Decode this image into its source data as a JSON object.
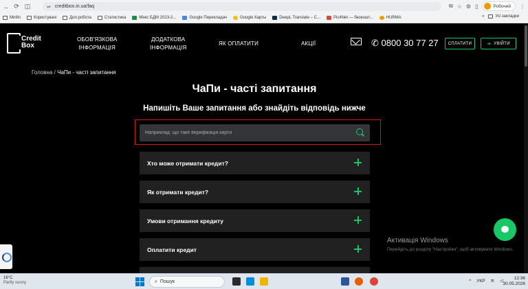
{
  "browser": {
    "url": "creditbox.in.ua/faq",
    "profile_label": "Робочий",
    "bookmarks": [
      "Minfin",
      "Користувачі",
      "Доп.робота",
      "Статистика",
      "Мініс БДМ 2023-2...",
      "Google Перекладач",
      "Google Карты",
      "DeepL Translate – C...",
      "Pic4Net — безкошт...",
      "HURMA"
    ],
    "bookmarks_more": "»",
    "all_bookmarks": "Усі закладки"
  },
  "header": {
    "logo_line1": "Credit",
    "logo_line2": "Box",
    "nav": [
      {
        "line1": "ОБОВ'ЯЗКОВА",
        "line2": "ІНФОРМАЦІЯ"
      },
      {
        "line1": "ДОДАТКОВА",
        "line2": "ІНФОРМАЦІЯ"
      },
      {
        "line1": "ЯК ОПЛАТИТИ",
        "line2": ""
      },
      {
        "line1": "АКЦІЇ",
        "line2": ""
      }
    ],
    "phone": "0800 30 77 27",
    "pay_button": "СПЛАТИТИ",
    "login_button": "УВІЙТИ"
  },
  "breadcrumb": {
    "home": "Головна",
    "separator": "/",
    "current": "ЧаПи - часті запитання"
  },
  "page_title": "ЧаПи - часті запитання",
  "subtitle": "Напишіть Ваше запитання або знайдіть відповідь нижче",
  "search": {
    "placeholder": "Наприклад: що таке верифікація карти"
  },
  "faq_items": [
    "Хто може отримати кредит?",
    "Як отримати кредит?",
    "Умови отримання кредиту",
    "Оплатити кредит"
  ],
  "activation": {
    "title": "Активація Windows",
    "text": "Перейдіть до розділу \"Настройки\", щоб активувати Windows."
  },
  "taskbar": {
    "temp": "16°C",
    "weather": "Partly sunny",
    "search_label": "Пошук",
    "lang": "УКР",
    "time": "12:36",
    "date": "30.05.2026"
  },
  "colors": {
    "accent": "#17c964",
    "highlight_red": "#d61a1a",
    "faq_bg": "#212121"
  }
}
